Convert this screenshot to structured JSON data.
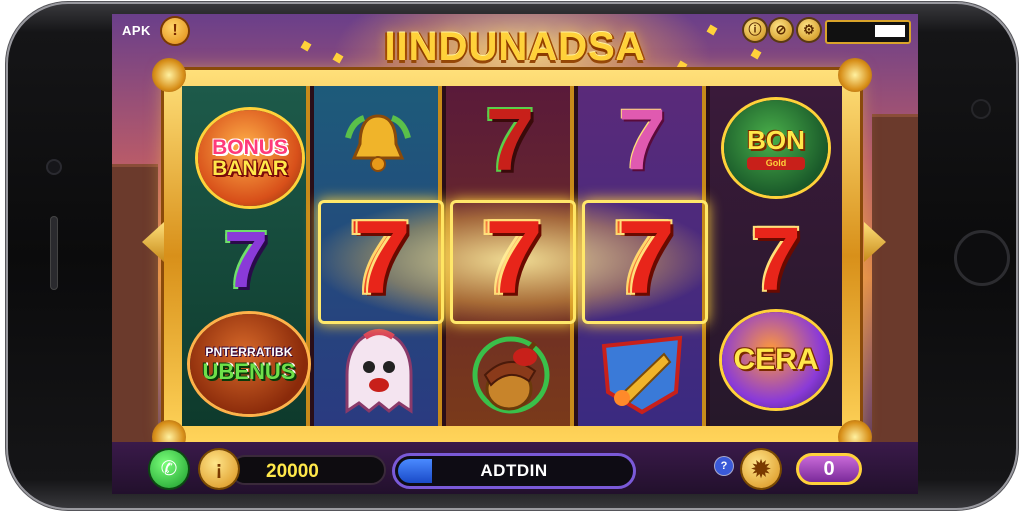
{
  "top_bar": {
    "apk_label": "APK",
    "alert_icon": "!",
    "title": "IINDUNADSA",
    "hud_icon_1": "ⓘ",
    "hud_icon_2": "⊘",
    "hud_settings_icon": "⚙"
  },
  "reels": {
    "reel1": {
      "top_line1": "BONUS",
      "top_line2": "BANAR",
      "middle": "7",
      "bottom_line1": "PNTERRATIBK",
      "bottom_line2": "UBENUS"
    },
    "reel2": {
      "top_icon": "bell",
      "middle": "7",
      "bottom_icon": "ghost"
    },
    "reel3": {
      "top": "7",
      "middle": "7",
      "bottom_icon": "acorn"
    },
    "reel4": {
      "top": "7",
      "middle": "7",
      "bottom_icon": "rocket"
    },
    "reel5": {
      "top_line1": "BON",
      "top_line2": "Gold",
      "middle": "7",
      "bottom_line1": "CERA"
    }
  },
  "bottom_bar": {
    "call_icon": "✆",
    "coin_icon": "¡",
    "balance": "20000",
    "action_label": "ADTDIN",
    "info_icon": "?",
    "settings_icon": "✹",
    "counter": "0"
  },
  "colors": {
    "gold": "#ffd23a",
    "seven_red": "#e8251a",
    "frame_dark": "#2a0e18",
    "accent_purple": "#7a5ad8"
  }
}
